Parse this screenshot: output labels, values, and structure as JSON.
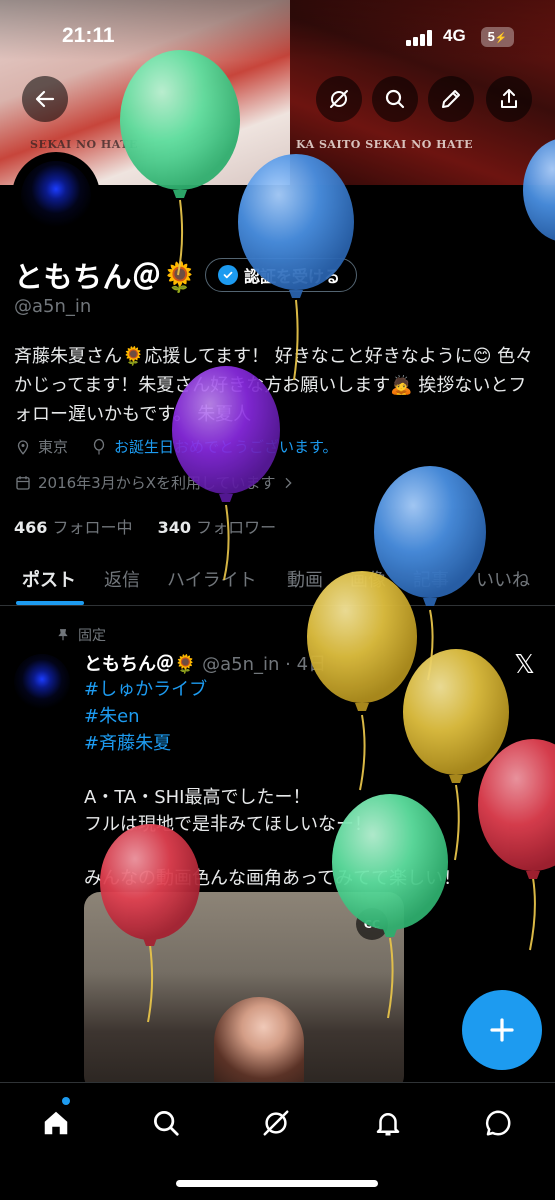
{
  "status_bar": {
    "time": "21:11",
    "network": "4G",
    "battery": "5"
  },
  "banner": {
    "left_text": "SEKAI NO HATE",
    "right_text": "KA SAITO SEKAI NO HATE"
  },
  "header_icons": [
    "back-arrow-icon",
    "grok-icon",
    "search-icon",
    "edit-icon",
    "share-icon"
  ],
  "profile": {
    "display_name": "ともちん＠🌻",
    "verify_label": "認証を受ける",
    "handle": "@a5n_in",
    "bio": "斉藤朱夏さん🌻応援してます！ 好きなこと好きなように😊 色々かじってます！朱夏さん好きな方お願いします🙇 挨拶ないとフォロー遅いかもです。 朱夏人",
    "location": "東京",
    "birthday_link": "お誕生日おめでとうございます。",
    "joined": "2016年3月からXを利用しています",
    "following_count": "466",
    "following_label": "フォロー中",
    "followers_count": "340",
    "followers_label": "フォロワー"
  },
  "tabs": [
    {
      "label": "ポスト",
      "active": true
    },
    {
      "label": "返信"
    },
    {
      "label": "ハイライト"
    },
    {
      "label": "動画"
    },
    {
      "label": "画像"
    },
    {
      "label": "記事"
    },
    {
      "label": "いいね"
    }
  ],
  "pinned_post": {
    "pinned_label": "固定",
    "name": "ともちん＠🌻",
    "handle_time": "@a5n_in · 4日",
    "hashtags": [
      "#しゅかライブ",
      "#朱en",
      "#斉藤朱夏"
    ],
    "line1": "A・TA・SHI最高でしたー！",
    "line2": "フルは現地で是非みてほしいなー！",
    "line3": "みんなの動画色んな画角あってみてて楽しい！",
    "cc_label": "CC"
  },
  "bottom_nav": [
    "home-icon",
    "search-icon",
    "grok-icon",
    "notifications-icon",
    "messages-icon"
  ],
  "colors": {
    "accent": "#1d9bf0",
    "balloon_green": "#5ee0a0",
    "balloon_blue": "#4a90e2",
    "balloon_purple": "#8a2be2",
    "balloon_yellow": "#e0c040",
    "balloon_red": "#e04050"
  }
}
